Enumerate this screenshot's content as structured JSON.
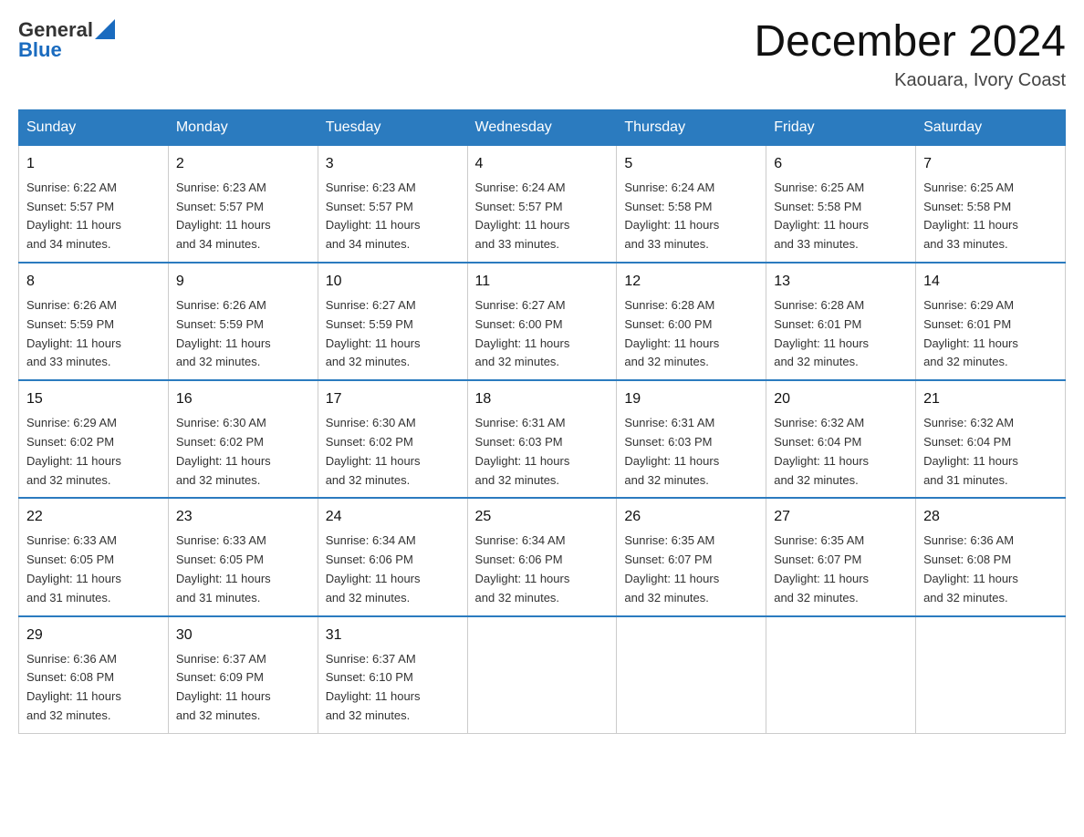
{
  "header": {
    "logo_general": "General",
    "logo_blue": "Blue",
    "month_title": "December 2024",
    "location": "Kaouara, Ivory Coast"
  },
  "days_of_week": [
    "Sunday",
    "Monday",
    "Tuesday",
    "Wednesday",
    "Thursday",
    "Friday",
    "Saturday"
  ],
  "weeks": [
    [
      {
        "day": "1",
        "sunrise": "6:22 AM",
        "sunset": "5:57 PM",
        "daylight": "11 hours and 34 minutes."
      },
      {
        "day": "2",
        "sunrise": "6:23 AM",
        "sunset": "5:57 PM",
        "daylight": "11 hours and 34 minutes."
      },
      {
        "day": "3",
        "sunrise": "6:23 AM",
        "sunset": "5:57 PM",
        "daylight": "11 hours and 34 minutes."
      },
      {
        "day": "4",
        "sunrise": "6:24 AM",
        "sunset": "5:57 PM",
        "daylight": "11 hours and 33 minutes."
      },
      {
        "day": "5",
        "sunrise": "6:24 AM",
        "sunset": "5:58 PM",
        "daylight": "11 hours and 33 minutes."
      },
      {
        "day": "6",
        "sunrise": "6:25 AM",
        "sunset": "5:58 PM",
        "daylight": "11 hours and 33 minutes."
      },
      {
        "day": "7",
        "sunrise": "6:25 AM",
        "sunset": "5:58 PM",
        "daylight": "11 hours and 33 minutes."
      }
    ],
    [
      {
        "day": "8",
        "sunrise": "6:26 AM",
        "sunset": "5:59 PM",
        "daylight": "11 hours and 33 minutes."
      },
      {
        "day": "9",
        "sunrise": "6:26 AM",
        "sunset": "5:59 PM",
        "daylight": "11 hours and 32 minutes."
      },
      {
        "day": "10",
        "sunrise": "6:27 AM",
        "sunset": "5:59 PM",
        "daylight": "11 hours and 32 minutes."
      },
      {
        "day": "11",
        "sunrise": "6:27 AM",
        "sunset": "6:00 PM",
        "daylight": "11 hours and 32 minutes."
      },
      {
        "day": "12",
        "sunrise": "6:28 AM",
        "sunset": "6:00 PM",
        "daylight": "11 hours and 32 minutes."
      },
      {
        "day": "13",
        "sunrise": "6:28 AM",
        "sunset": "6:01 PM",
        "daylight": "11 hours and 32 minutes."
      },
      {
        "day": "14",
        "sunrise": "6:29 AM",
        "sunset": "6:01 PM",
        "daylight": "11 hours and 32 minutes."
      }
    ],
    [
      {
        "day": "15",
        "sunrise": "6:29 AM",
        "sunset": "6:02 PM",
        "daylight": "11 hours and 32 minutes."
      },
      {
        "day": "16",
        "sunrise": "6:30 AM",
        "sunset": "6:02 PM",
        "daylight": "11 hours and 32 minutes."
      },
      {
        "day": "17",
        "sunrise": "6:30 AM",
        "sunset": "6:02 PM",
        "daylight": "11 hours and 32 minutes."
      },
      {
        "day": "18",
        "sunrise": "6:31 AM",
        "sunset": "6:03 PM",
        "daylight": "11 hours and 32 minutes."
      },
      {
        "day": "19",
        "sunrise": "6:31 AM",
        "sunset": "6:03 PM",
        "daylight": "11 hours and 32 minutes."
      },
      {
        "day": "20",
        "sunrise": "6:32 AM",
        "sunset": "6:04 PM",
        "daylight": "11 hours and 32 minutes."
      },
      {
        "day": "21",
        "sunrise": "6:32 AM",
        "sunset": "6:04 PM",
        "daylight": "11 hours and 31 minutes."
      }
    ],
    [
      {
        "day": "22",
        "sunrise": "6:33 AM",
        "sunset": "6:05 PM",
        "daylight": "11 hours and 31 minutes."
      },
      {
        "day": "23",
        "sunrise": "6:33 AM",
        "sunset": "6:05 PM",
        "daylight": "11 hours and 31 minutes."
      },
      {
        "day": "24",
        "sunrise": "6:34 AM",
        "sunset": "6:06 PM",
        "daylight": "11 hours and 32 minutes."
      },
      {
        "day": "25",
        "sunrise": "6:34 AM",
        "sunset": "6:06 PM",
        "daylight": "11 hours and 32 minutes."
      },
      {
        "day": "26",
        "sunrise": "6:35 AM",
        "sunset": "6:07 PM",
        "daylight": "11 hours and 32 minutes."
      },
      {
        "day": "27",
        "sunrise": "6:35 AM",
        "sunset": "6:07 PM",
        "daylight": "11 hours and 32 minutes."
      },
      {
        "day": "28",
        "sunrise": "6:36 AM",
        "sunset": "6:08 PM",
        "daylight": "11 hours and 32 minutes."
      }
    ],
    [
      {
        "day": "29",
        "sunrise": "6:36 AM",
        "sunset": "6:08 PM",
        "daylight": "11 hours and 32 minutes."
      },
      {
        "day": "30",
        "sunrise": "6:37 AM",
        "sunset": "6:09 PM",
        "daylight": "11 hours and 32 minutes."
      },
      {
        "day": "31",
        "sunrise": "6:37 AM",
        "sunset": "6:10 PM",
        "daylight": "11 hours and 32 minutes."
      },
      null,
      null,
      null,
      null
    ]
  ],
  "labels": {
    "sunrise_prefix": "Sunrise: ",
    "sunset_prefix": "Sunset: ",
    "daylight_prefix": "Daylight: "
  }
}
